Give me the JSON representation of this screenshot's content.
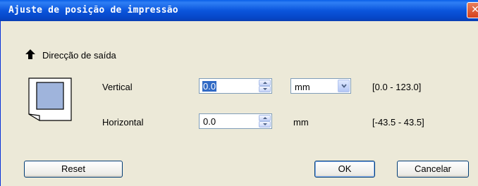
{
  "window": {
    "title": "Ajuste de posição de impressão",
    "close_glyph": "✕"
  },
  "output_direction": {
    "label": "Direcção de saída",
    "icon": "arrow-up-icon"
  },
  "vertical": {
    "label": "Vertical",
    "value": "0.0",
    "unit": "mm",
    "range": "[0.0 - 123.0]"
  },
  "horizontal": {
    "label": "Horizontal",
    "value": "0.0",
    "unit": "mm",
    "range": "[-43.5 - 43.5]"
  },
  "buttons": {
    "reset": "Reset",
    "ok": "OK",
    "cancel": "Cancelar"
  },
  "colors": {
    "titlebar": "#0b55dc",
    "dialog_bg": "#ece9d8",
    "selection": "#316ac5",
    "page_preview_fill": "#9fb4dc"
  }
}
